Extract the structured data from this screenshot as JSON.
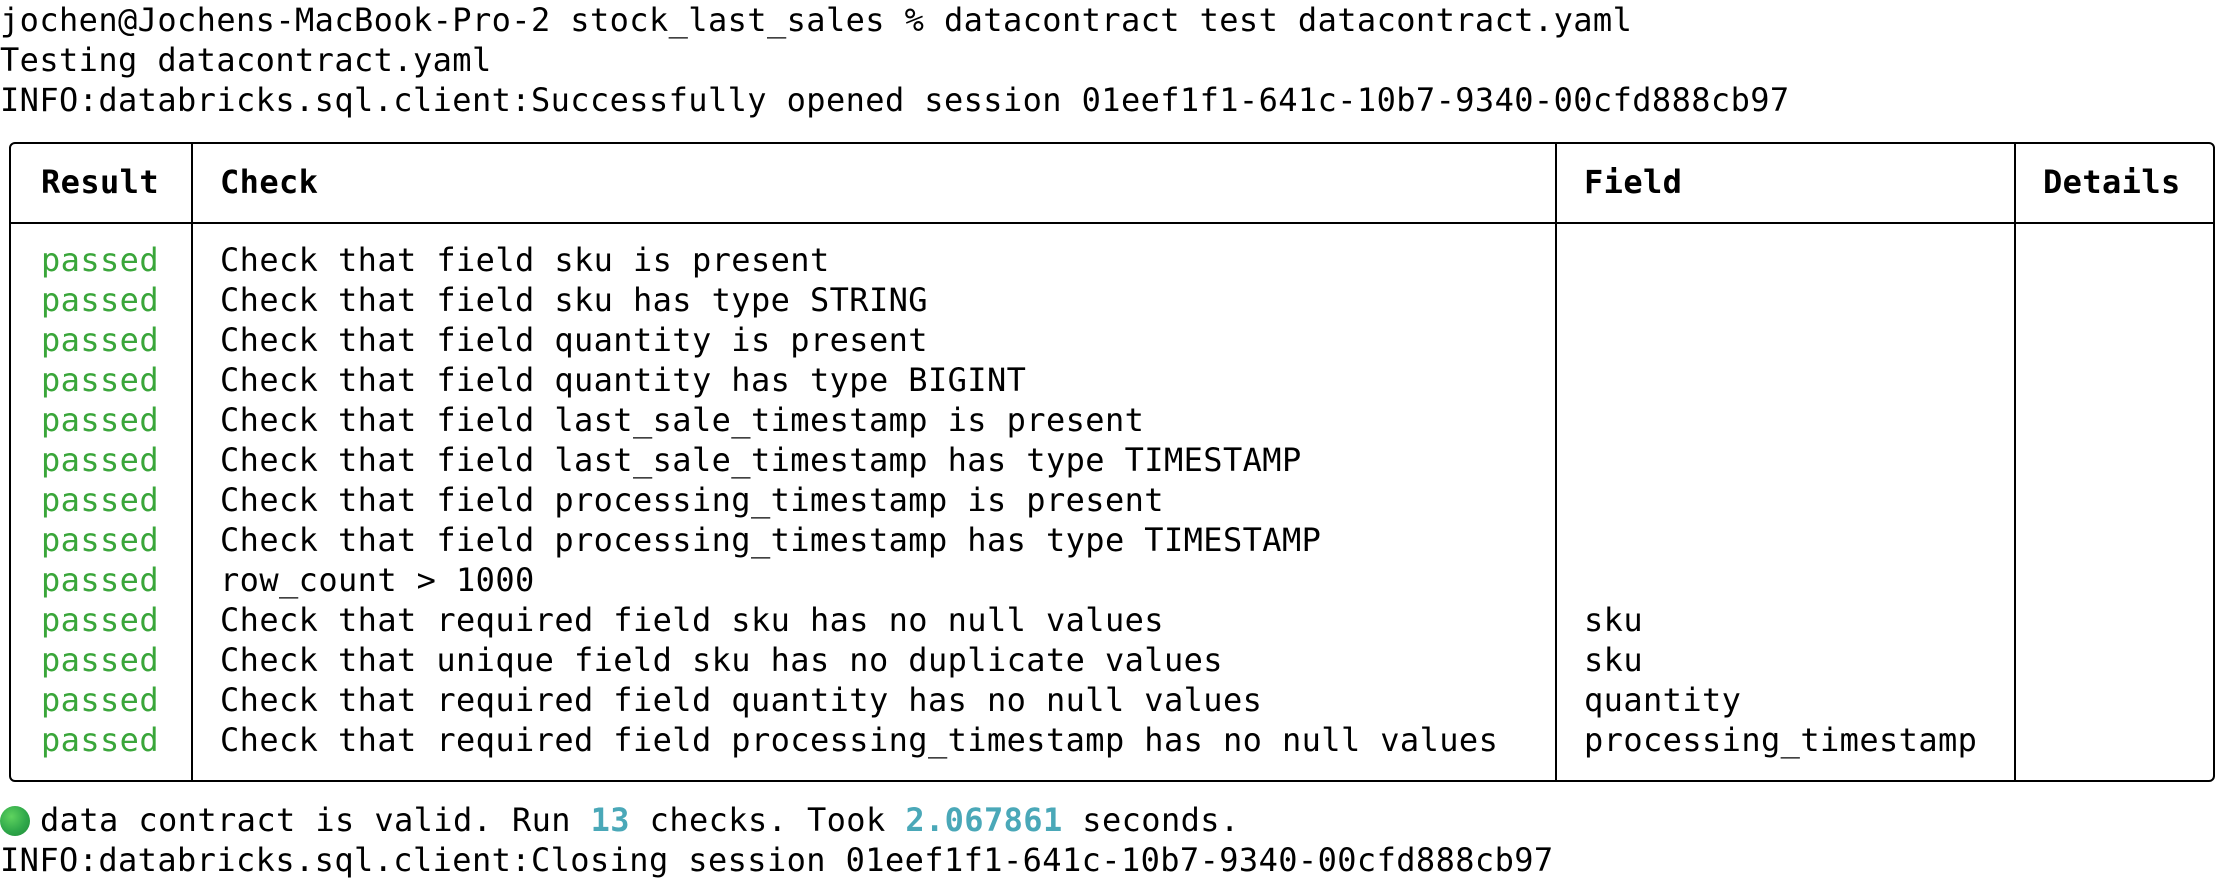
{
  "colors": {
    "passed": "#3aa63a",
    "accent": "#4aa8b8",
    "status_dot": "#2fa84a"
  },
  "terminal": {
    "prompt_line": "jochen@Jochens-MacBook-Pro-2 stock_last_sales % datacontract test datacontract.yaml",
    "testing_line": "Testing datacontract.yaml",
    "session_open_line": "INFO:databricks.sql.client:Successfully opened session 01eef1f1-641c-10b7-9340-00cfd888cb97",
    "summary": {
      "icon": "green-circle-icon",
      "text_1": "data contract is valid. Run ",
      "check_count": "13",
      "text_2": " checks. Took ",
      "duration": "2.067861",
      "text_3": " seconds."
    },
    "session_close_line": "INFO:databricks.sql.client:Closing session 01eef1f1-641c-10b7-9340-00cfd888cb97"
  },
  "table": {
    "headers": {
      "result": "Result",
      "check": "Check",
      "field": "Field",
      "details": "Details"
    },
    "rows": [
      {
        "result": "passed",
        "check": "Check that field sku is present",
        "field": "",
        "details": ""
      },
      {
        "result": "passed",
        "check": "Check that field sku has type STRING",
        "field": "",
        "details": ""
      },
      {
        "result": "passed",
        "check": "Check that field quantity is present",
        "field": "",
        "details": ""
      },
      {
        "result": "passed",
        "check": "Check that field quantity has type BIGINT",
        "field": "",
        "details": ""
      },
      {
        "result": "passed",
        "check": "Check that field last_sale_timestamp is present",
        "field": "",
        "details": ""
      },
      {
        "result": "passed",
        "check": "Check that field last_sale_timestamp has type TIMESTAMP",
        "field": "",
        "details": ""
      },
      {
        "result": "passed",
        "check": "Check that field processing_timestamp is present",
        "field": "",
        "details": ""
      },
      {
        "result": "passed",
        "check": "Check that field processing_timestamp has type TIMESTAMP",
        "field": "",
        "details": ""
      },
      {
        "result": "passed",
        "check": "row_count > 1000",
        "field": "",
        "details": ""
      },
      {
        "result": "passed",
        "check": "Check that required field sku has no null values",
        "field": "sku",
        "details": ""
      },
      {
        "result": "passed",
        "check": "Check that unique field sku has no duplicate values",
        "field": "sku",
        "details": ""
      },
      {
        "result": "passed",
        "check": "Check that required field quantity has no null values",
        "field": "quantity",
        "details": ""
      },
      {
        "result": "passed",
        "check": "Check that required field processing_timestamp has no null values",
        "field": "processing_timestamp",
        "details": ""
      }
    ]
  }
}
